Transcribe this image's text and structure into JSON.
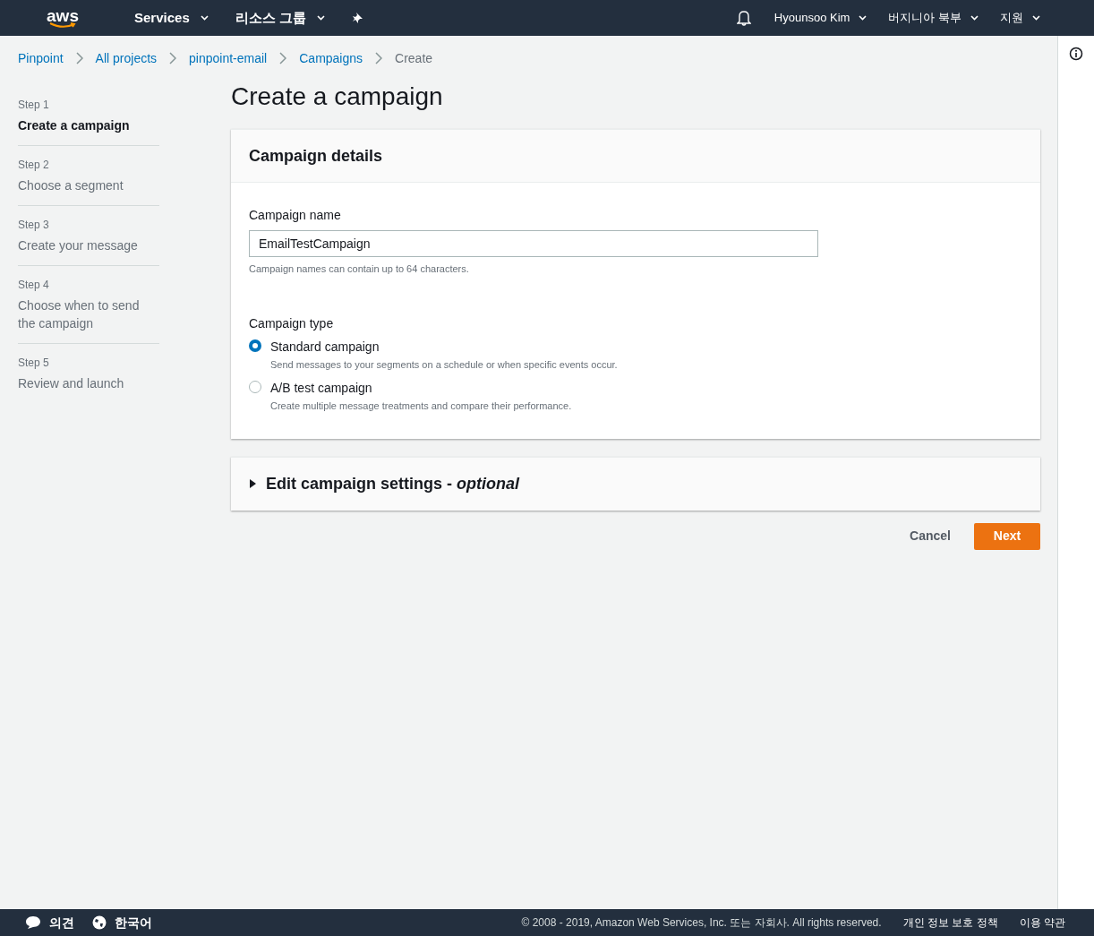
{
  "top_nav": {
    "logo": "aws",
    "menus": [
      {
        "label": "Services"
      },
      {
        "label": "리소스 그룹"
      }
    ],
    "user_menus": [
      {
        "label": "Hyounsoo Kim"
      },
      {
        "label": "버지니아 북부"
      },
      {
        "label": "지원"
      }
    ]
  },
  "breadcrumbs": [
    {
      "label": "Pinpoint",
      "link": true
    },
    {
      "label": "All projects",
      "link": true
    },
    {
      "label": "pinpoint-email",
      "link": true
    },
    {
      "label": "Campaigns",
      "link": true
    },
    {
      "label": "Create",
      "link": false
    }
  ],
  "steps": [
    {
      "step": "Step 1",
      "label": "Create a campaign",
      "selected": true
    },
    {
      "step": "Step 2",
      "label": "Choose a segment",
      "selected": false
    },
    {
      "step": "Step 3",
      "label": "Create your message",
      "selected": false
    },
    {
      "step": "Step 4",
      "label": "Choose when to send the campaign",
      "selected": false
    },
    {
      "step": "Step 5",
      "label": "Review and launch",
      "selected": false
    }
  ],
  "page_title": "Create a campaign",
  "campaign_details": {
    "title": "Campaign details",
    "name_label": "Campaign name",
    "name_value": "EmailTestCampaign",
    "name_hint": "Campaign names can contain up to 64 characters.",
    "type_label": "Campaign type",
    "types": [
      {
        "label": "Standard campaign",
        "description": "Send messages to your segments on a schedule or when specific events occur.",
        "selected": true
      },
      {
        "label": "A/B test campaign",
        "description": "Create multiple message treatments and compare their performance.",
        "selected": false
      }
    ]
  },
  "settings_section": {
    "title": "Edit campaign settings - *optional*",
    "expanded": false
  },
  "buttons": [
    {
      "label": "Cancel",
      "kind": "link"
    },
    {
      "label": "Next",
      "kind": "primary"
    }
  ],
  "footer": {
    "left": [
      {
        "label": "의견"
      },
      {
        "label": "한국어"
      }
    ],
    "copyright": "© 2008 - 2019, Amazon Web Services, Inc. 또는 자회사. All rights reserved.",
    "links": [
      {
        "label": "개인 정보 보호 정책"
      },
      {
        "label": "이용 약관"
      }
    ]
  }
}
